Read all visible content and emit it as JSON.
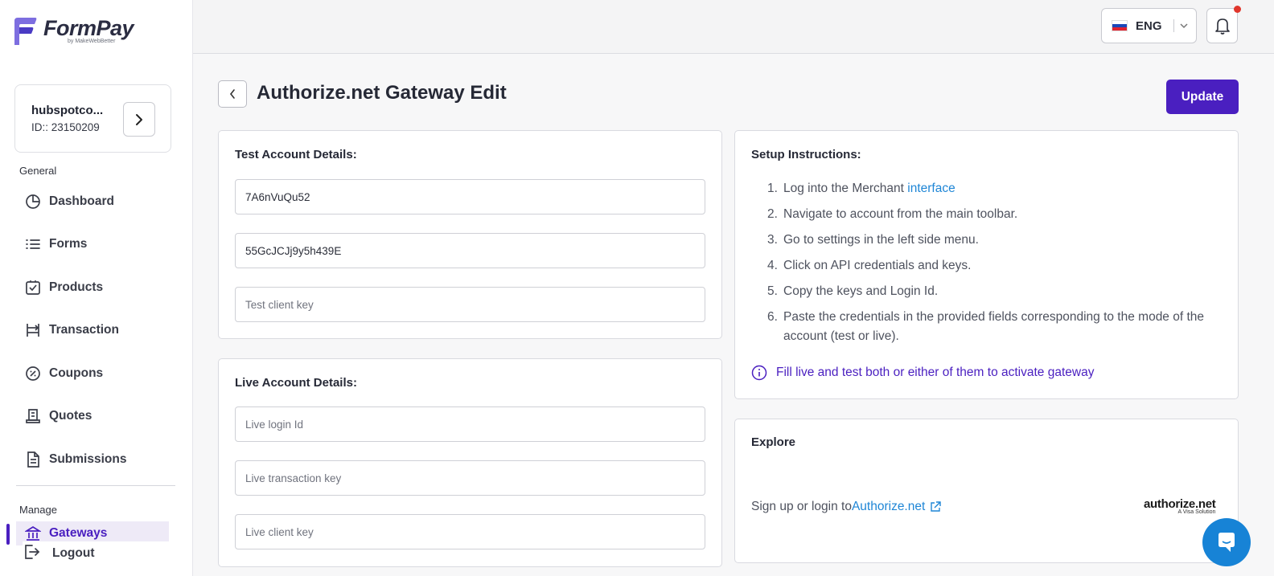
{
  "brand": {
    "name": "FormPay",
    "sub": "by MakeWebBetter"
  },
  "account": {
    "name": "hubspotco...",
    "id": "ID:: 23150209"
  },
  "sidebar": {
    "general_label": "General",
    "manage_label": "Manage",
    "items": [
      {
        "label": "Dashboard",
        "icon": "pie-chart-icon"
      },
      {
        "label": "Forms",
        "icon": "list-icon"
      },
      {
        "label": "Products",
        "icon": "product-icon"
      },
      {
        "label": "Transaction",
        "icon": "transaction-icon"
      },
      {
        "label": "Coupons",
        "icon": "coupon-icon"
      },
      {
        "label": "Quotes",
        "icon": "quote-icon"
      },
      {
        "label": "Submissions",
        "icon": "document-icon"
      }
    ],
    "gateways_label": "Gateways",
    "logout_label": "Logout"
  },
  "topbar": {
    "language": "ENG",
    "flag_colors": [
      "#ffffff",
      "#1a47b8",
      "#e0222f"
    ],
    "notification_dot_color": "#e0362c"
  },
  "page": {
    "title": "Authorize.net Gateway Edit",
    "update_label": "Update"
  },
  "test_account": {
    "title": "Test Account Details:",
    "login_id": "7A6nVuQu52",
    "transaction_key": "55GcJCJj9y5h439E",
    "client_key_placeholder": "Test client key"
  },
  "live_account": {
    "title": "Live Account Details:",
    "login_id_placeholder": "Live login Id",
    "transaction_key_placeholder": "Live transaction key",
    "client_key_placeholder": "Live client key"
  },
  "setup": {
    "title": "Setup Instructions:",
    "steps": [
      {
        "num": "1.",
        "text": "Log into the Merchant ",
        "link": "interface"
      },
      {
        "num": "2.",
        "text": "Navigate to account from the main toolbar."
      },
      {
        "num": "3.",
        "text": "Go to settings in the left side menu."
      },
      {
        "num": "4.",
        "text": "Click on API credentials and keys."
      },
      {
        "num": "5.",
        "text": "Copy the keys and Login Id."
      },
      {
        "num": "6.",
        "text": "Paste the credentials in the provided fields corresponding to the mode of the account (test or live)."
      }
    ],
    "note": "Fill live and test both or either of them to activate gateway"
  },
  "explore": {
    "title": "Explore",
    "text": "Sign up or login to ",
    "link": "Authorize.net",
    "logo_main": "authorize.net",
    "logo_sub": "A Visa Solution"
  },
  "colors": {
    "accent": "#4a1fc0",
    "link": "#1f86d6",
    "chat": "#1783d6"
  }
}
